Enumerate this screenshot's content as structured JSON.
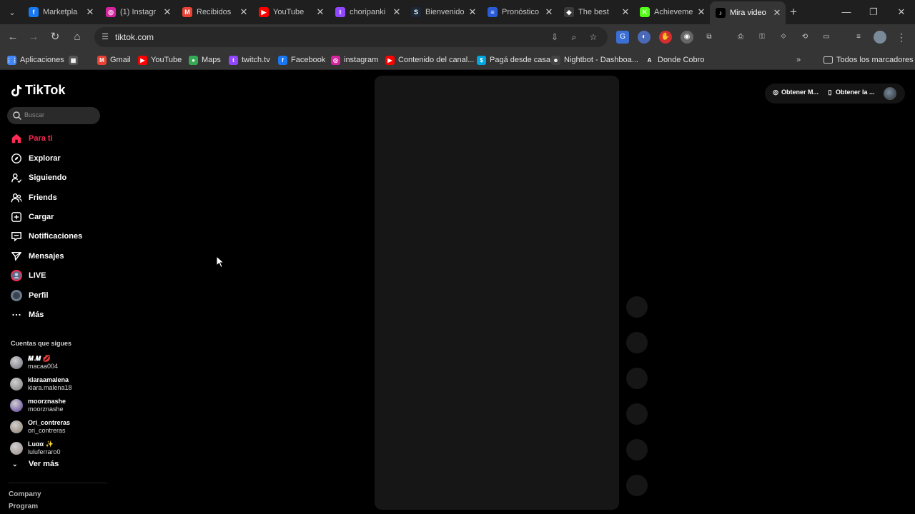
{
  "browser": {
    "tabs": [
      {
        "title": "Marketpla",
        "icon": "facebook-icon",
        "color": "#1877f2",
        "glyph": "f"
      },
      {
        "title": "(1) Instagr",
        "icon": "instagram-icon",
        "color": "#d6249f",
        "glyph": "◎"
      },
      {
        "title": "Recibidos",
        "icon": "gmail-icon",
        "color": "#ea4335",
        "glyph": "M"
      },
      {
        "title": "YouTube",
        "icon": "youtube-icon",
        "color": "#ff0000",
        "glyph": "▶"
      },
      {
        "title": "choripanki",
        "icon": "twitch-icon",
        "color": "#9146ff",
        "glyph": "t"
      },
      {
        "title": "Bienvenido",
        "icon": "steam-icon",
        "color": "#1b2838",
        "glyph": "S"
      },
      {
        "title": "Pronóstico",
        "icon": "weather-icon",
        "color": "#2a5bd7",
        "glyph": "≡"
      },
      {
        "title": "The best",
        "icon": "diamond-icon",
        "color": "#3a3a3a",
        "glyph": "◆"
      },
      {
        "title": "Achieveme",
        "icon": "kick-icon",
        "color": "#53fc18",
        "glyph": "K"
      },
      {
        "title": "Mira video",
        "icon": "tiktok-icon",
        "color": "#000000",
        "glyph": "♪",
        "active": true
      }
    ],
    "url": "tiktok.com",
    "bookmarks": [
      {
        "label": "Aplicaciones",
        "icon": "apps-grid-icon",
        "color": "#4285f4",
        "glyph": "⋮⋮"
      },
      {
        "label": "",
        "icon": "grid-icon",
        "color": "#555555",
        "glyph": "▦"
      },
      {
        "label": "Gmail",
        "icon": "gmail-icon",
        "color": "#ea4335",
        "glyph": "M"
      },
      {
        "label": "YouTube",
        "icon": "youtube-icon",
        "color": "#ff0000",
        "glyph": "▶"
      },
      {
        "label": "Maps",
        "icon": "maps-pin-icon",
        "color": "#34a853",
        "glyph": "●"
      },
      {
        "label": "twitch.tv",
        "icon": "twitch-icon",
        "color": "#9146ff",
        "glyph": "t"
      },
      {
        "label": "Facebook",
        "icon": "facebook-icon",
        "color": "#1877f2",
        "glyph": "f"
      },
      {
        "label": "instagram",
        "icon": "instagram-icon",
        "color": "#d6249f",
        "glyph": "◎"
      },
      {
        "label": "Contenido del canal...",
        "icon": "youtube-studio-icon",
        "color": "#ff0000",
        "glyph": "▶"
      },
      {
        "label": "Pagá desde casa",
        "icon": "payment-icon",
        "color": "#00a6e0",
        "glyph": "$"
      },
      {
        "label": "Nightbot - Dashboa...",
        "icon": "nightbot-icon",
        "color": "#444444",
        "glyph": "☻"
      },
      {
        "label": "Donde Cobro",
        "icon": "letter-a-icon",
        "color": "#353535",
        "glyph": "A"
      }
    ],
    "all_bookmarks_label": "Todos los marcadores"
  },
  "tiktok": {
    "logo_text": "TikTok",
    "search_placeholder": "Buscar",
    "nav": [
      {
        "label": "Para ti",
        "icon": "home-icon",
        "active": true
      },
      {
        "label": "Explorar",
        "icon": "compass-icon"
      },
      {
        "label": "Siguiendo",
        "icon": "following-icon"
      },
      {
        "label": "Friends",
        "icon": "friends-icon"
      },
      {
        "label": "Cargar",
        "icon": "upload-icon"
      },
      {
        "label": "Notificaciones",
        "icon": "notification-icon"
      },
      {
        "label": "Mensajes",
        "icon": "messages-icon"
      },
      {
        "label": "LIVE",
        "icon": "live-icon"
      },
      {
        "label": "Perfil",
        "icon": "profile-icon"
      },
      {
        "label": "Más",
        "icon": "more-icon"
      }
    ],
    "following_heading": "Cuentas que sigues",
    "following": [
      {
        "nickname": "𝑴.𝑴 💋",
        "username": "macaa004",
        "avatar_color": "#6a6a7a"
      },
      {
        "nickname": "klaraamalena",
        "username": "kiara.malena18",
        "avatar_color": "#7a7a7a"
      },
      {
        "nickname": "moorznashe",
        "username": "moorznashe",
        "avatar_color": "#5a3a9a"
      },
      {
        "nickname": "Ori_contreras",
        "username": "ori_contreras",
        "avatar_color": "#8a7a6a"
      },
      {
        "nickname": "Luαα ✨",
        "username": "luluferraro0",
        "avatar_color": "#9a8a8a"
      }
    ],
    "see_more": "Ver más",
    "footer_links": [
      "Company",
      "Program"
    ],
    "top_right": {
      "get_coins": "Obtener M...",
      "get_app": "Obtener la ..."
    },
    "accent_color": "#fe2c55"
  }
}
